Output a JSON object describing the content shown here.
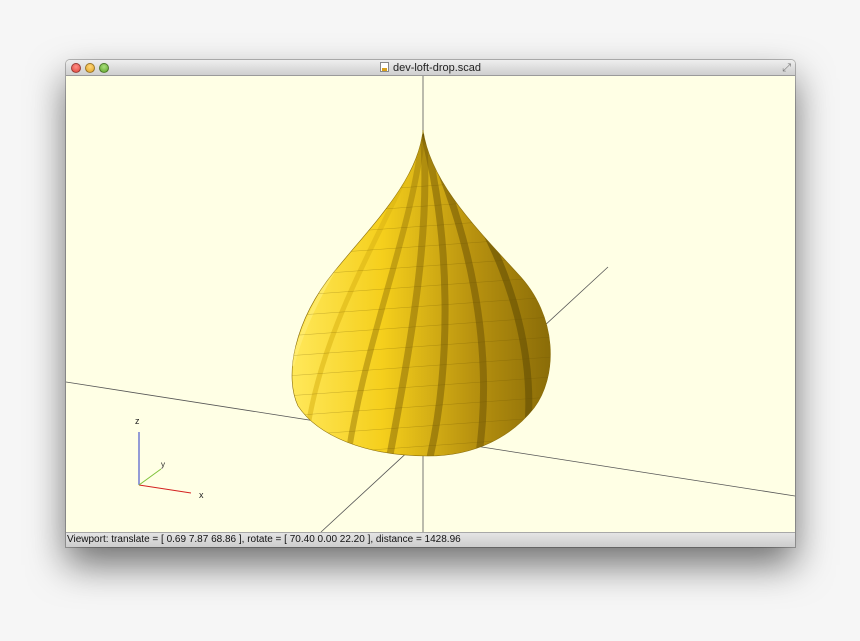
{
  "window": {
    "title": "dev-loft-drop.scad"
  },
  "axes_gizmo": {
    "x_label": "x",
    "y_label": "y",
    "z_label": "z",
    "x_color": "#d42020",
    "y_color": "#7ec23a",
    "z_color": "#2a3ac8"
  },
  "model": {
    "fill_color": "#f7d21c"
  },
  "statusbar": {
    "text": "Viewport: translate = [ 0.69 7.87 68.86 ], rotate = [ 70.40 0.00 22.20 ], distance = 1428.96"
  },
  "icons": {
    "document": "document-icon",
    "fullscreen": "fullscreen-icon"
  }
}
